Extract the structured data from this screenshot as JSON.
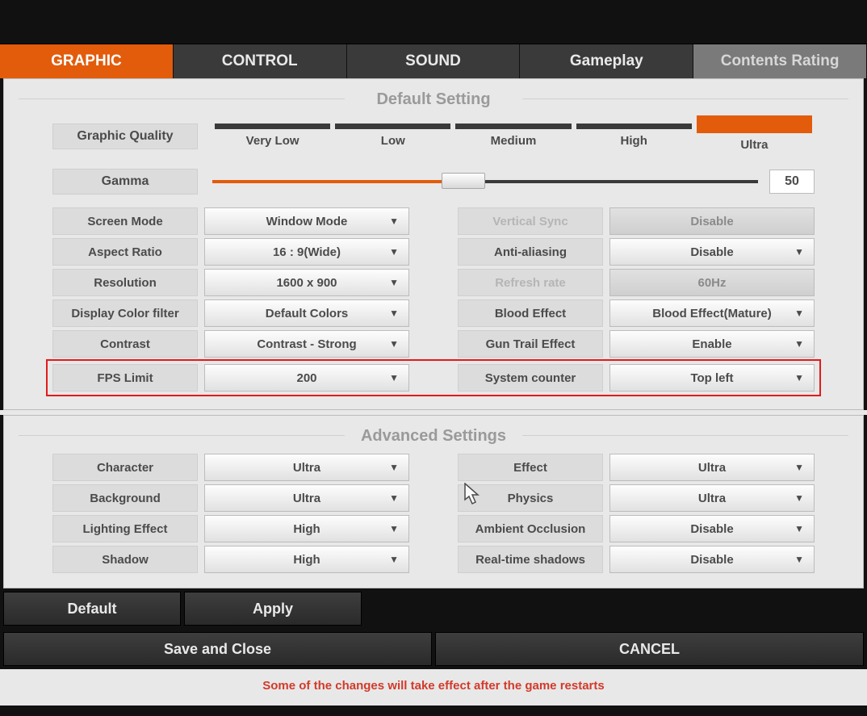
{
  "tabs": {
    "graphic": "GRAPHIC",
    "control": "CONTROL",
    "sound": "SOUND",
    "gameplay": "Gameplay",
    "rating": "Contents Rating"
  },
  "sections": {
    "default": "Default Setting",
    "advanced": "Advanced Settings"
  },
  "quality": {
    "label": "Graphic Quality",
    "levels": {
      "vl": "Very Low",
      "l": "Low",
      "m": "Medium",
      "h": "High",
      "u": "Ultra"
    },
    "active": "u"
  },
  "gamma": {
    "label": "Gamma",
    "value": "50",
    "pct": 46
  },
  "left": {
    "screen_mode": {
      "label": "Screen Mode",
      "value": "Window Mode"
    },
    "aspect": {
      "label": "Aspect Ratio",
      "value": "16 : 9(Wide)"
    },
    "resolution": {
      "label": "Resolution",
      "value": "1600 x 900"
    },
    "colorfilter": {
      "label": "Display Color filter",
      "value": "Default Colors"
    },
    "contrast": {
      "label": "Contrast",
      "value": "Contrast - Strong"
    },
    "fpslimit": {
      "label": "FPS Limit",
      "value": "200"
    }
  },
  "right": {
    "vsync": {
      "label": "Vertical Sync",
      "value": "Disable"
    },
    "aa": {
      "label": "Anti-aliasing",
      "value": "Disable"
    },
    "refresh": {
      "label": "Refresh rate",
      "value": "60Hz"
    },
    "blood": {
      "label": "Blood Effect",
      "value": "Blood Effect(Mature)"
    },
    "guntrail": {
      "label": "Gun Trail Effect",
      "value": "Enable"
    },
    "syscounter": {
      "label": "System counter",
      "value": "Top left"
    }
  },
  "adv_left": {
    "character": {
      "label": "Character",
      "value": "Ultra"
    },
    "background": {
      "label": "Background",
      "value": "Ultra"
    },
    "lighting": {
      "label": "Lighting Effect",
      "value": "High"
    },
    "shadow": {
      "label": "Shadow",
      "value": "High"
    }
  },
  "adv_right": {
    "effect": {
      "label": "Effect",
      "value": "Ultra"
    },
    "physics": {
      "label": "Physics",
      "value": "Ultra"
    },
    "ao": {
      "label": "Ambient Occlusion",
      "value": "Disable"
    },
    "rts": {
      "label": "Real-time shadows",
      "value": "Disable"
    }
  },
  "buttons": {
    "default": "Default",
    "apply": "Apply",
    "save": "Save and Close",
    "cancel": "CANCEL"
  },
  "warning": "Some of the changes will take effect after the game restarts"
}
